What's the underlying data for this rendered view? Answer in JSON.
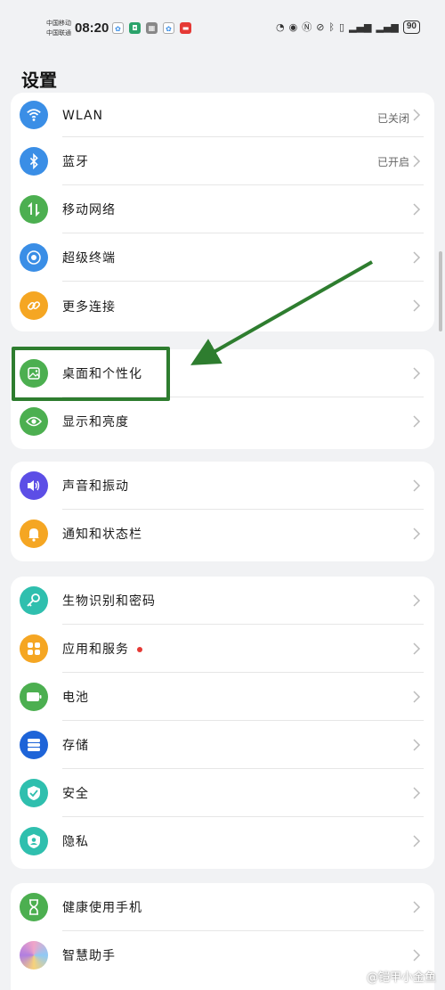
{
  "status_bar": {
    "carrier_1": "中国移动",
    "carrier_2": "中国联通",
    "time": "08:20",
    "battery": "90"
  },
  "page_title": "设置",
  "groups": [
    {
      "rows": [
        {
          "label": "WLAN",
          "status": "已关闭",
          "icon": "wifi-icon",
          "color": "#3a8ee6"
        },
        {
          "label": "蓝牙",
          "status": "已开启",
          "icon": "bluetooth-icon",
          "color": "#3a8ee6"
        },
        {
          "label": "移动网络",
          "icon": "mobile-network-icon",
          "color": "#4caf50"
        },
        {
          "label": "超级终端",
          "icon": "super-device-icon",
          "color": "#3a8ee6"
        },
        {
          "label": "更多连接",
          "icon": "link-icon",
          "color": "#f5a623"
        }
      ]
    },
    {
      "rows": [
        {
          "label": "桌面和个性化",
          "icon": "wallpaper-icon",
          "color": "#4caf50"
        },
        {
          "label": "显示和亮度",
          "icon": "eye-icon",
          "color": "#4caf50"
        }
      ]
    },
    {
      "rows": [
        {
          "label": "声音和振动",
          "icon": "speaker-icon",
          "color": "#5c4ee6"
        },
        {
          "label": "通知和状态栏",
          "icon": "bell-icon",
          "color": "#f5a623"
        }
      ]
    },
    {
      "rows": [
        {
          "label": "生物识别和密码",
          "icon": "key-icon",
          "color": "#2fbfae"
        },
        {
          "label": "应用和服务",
          "icon": "apps-icon",
          "color": "#f5a623",
          "badge": true
        },
        {
          "label": "电池",
          "icon": "battery-icon",
          "color": "#4caf50"
        },
        {
          "label": "存储",
          "icon": "storage-icon",
          "color": "#1e64d8"
        },
        {
          "label": "安全",
          "icon": "shield-icon",
          "color": "#2fbfae"
        },
        {
          "label": "隐私",
          "icon": "privacy-icon",
          "color": "#2fbfae"
        }
      ]
    },
    {
      "rows": [
        {
          "label": "健康使用手机",
          "icon": "hourglass-icon",
          "color": "#4caf50"
        },
        {
          "label": "智慧助手",
          "icon": "assistant-icon",
          "color": "#b07ee0"
        }
      ]
    }
  ],
  "watermark": "@铠甲小金鱼",
  "annotation_color": "#2e7d2f"
}
